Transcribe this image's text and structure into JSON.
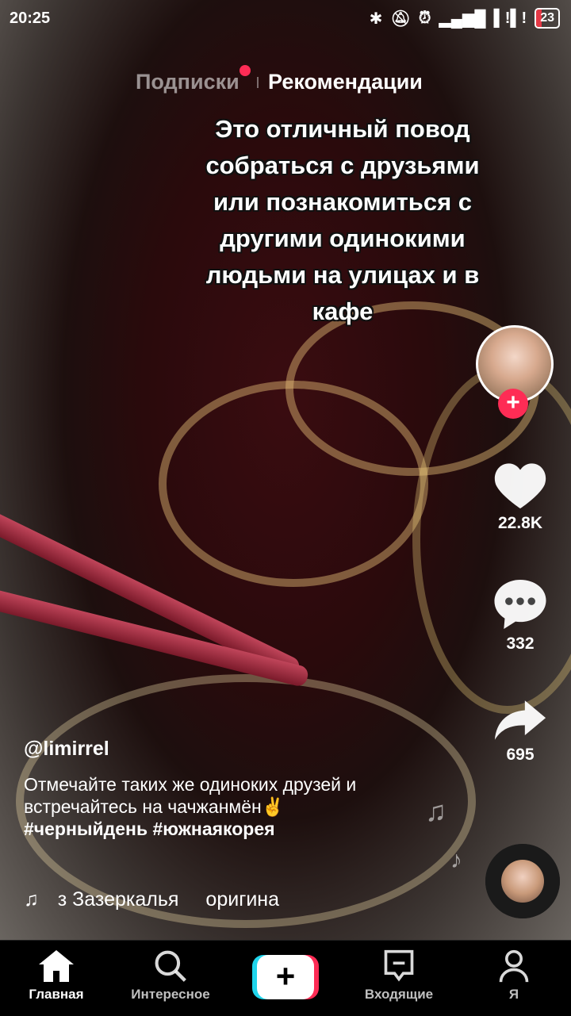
{
  "status_bar": {
    "time": "20:25",
    "battery": "23"
  },
  "feed_tabs": {
    "following": "Подписки",
    "for_you": "Рекомендации"
  },
  "overlay_caption": "Это отличный повод собраться с друзьями или познакомиться с другими одинокими людьми на улицах и в кафе",
  "actions": {
    "likes": "22.8K",
    "comments": "332",
    "shares": "695"
  },
  "post": {
    "username": "@limirrel",
    "description": "Отмечайте таких же одиноких друзей и встречайтесь на чачжанмён✌️",
    "hashtags": [
      "#черныйдень",
      "#южнаякорея"
    ]
  },
  "music": {
    "text1": "з Зазеркалья",
    "text2": "оригина"
  },
  "nav": {
    "home": "Главная",
    "discover": "Интересное",
    "create": "+",
    "inbox": "Входящие",
    "profile": "Я"
  },
  "colors": {
    "accent_red": "#fe2c55",
    "accent_cyan": "#20d5ec"
  }
}
